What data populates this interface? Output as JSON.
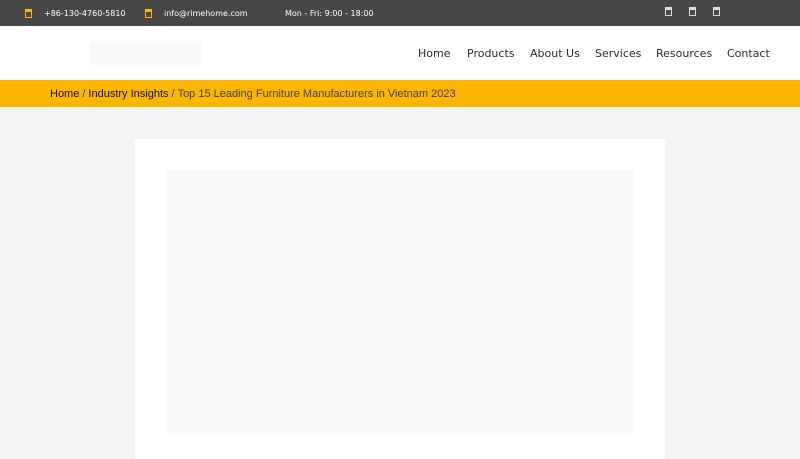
{
  "topbar": {
    "phone": "+86-130-4760-5810",
    "phone_icon": "phone-icon",
    "email": "info@rimehome.com",
    "email_icon": "mail-icon",
    "hours": "Mon - Fri: 9:00 - 18:00",
    "social_icons": [
      "facebook-icon",
      "linkedin-icon",
      "youtube-icon"
    ],
    "icon_color": "#f5b400",
    "background": "#474747"
  },
  "header": {
    "nav": {
      "home": "Home",
      "products": "Products",
      "about": "About Us",
      "services": "Services",
      "resources": "Resources",
      "contact": "Contact"
    }
  },
  "breadcrumb": {
    "home": "Home",
    "separator": "/",
    "category": "Industry Insights",
    "current": "Top 15 Leading Furniture Manufacturers in Vietnam 2023",
    "background": "#fbb502"
  }
}
